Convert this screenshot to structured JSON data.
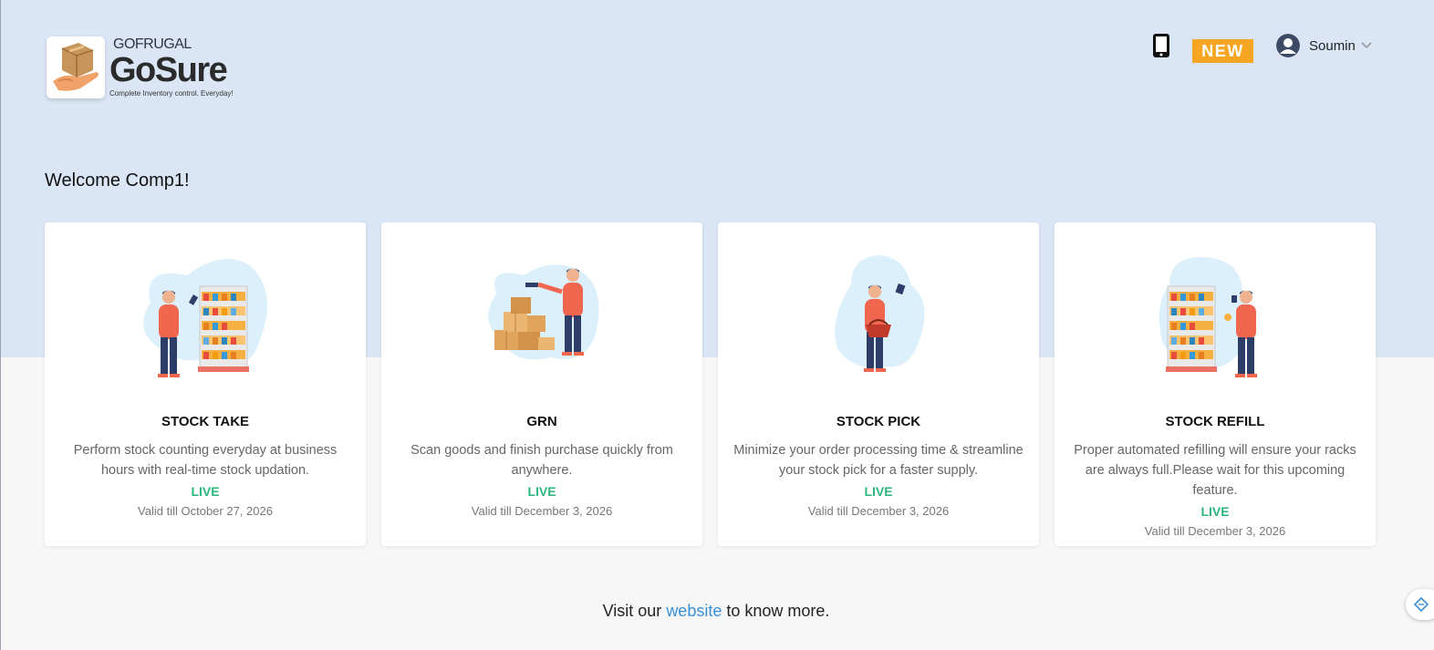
{
  "brand": {
    "company": "GOFRUGAL",
    "product": "GoSure",
    "tagline": "Complete Inventory control. Everyday!"
  },
  "header": {
    "new_badge": "NEW",
    "user_name": "Soumin"
  },
  "welcome": "Welcome Comp1!",
  "cards": [
    {
      "title": "STOCK TAKE",
      "description": "Perform stock counting everyday at business hours with real-time stock updation.",
      "status": "LIVE",
      "valid": "Valid till October 27, 2026",
      "icon": "stock-take-illustration"
    },
    {
      "title": "GRN",
      "description": "Scan goods and finish purchase quickly from anywhere.",
      "status": "LIVE",
      "valid": "Valid till December 3, 2026",
      "icon": "grn-illustration"
    },
    {
      "title": "STOCK PICK",
      "description": "Minimize your order processing time & streamline your stock pick for a faster supply.",
      "status": "LIVE",
      "valid": "Valid till December 3, 2026",
      "icon": "stock-pick-illustration"
    },
    {
      "title": "STOCK REFILL",
      "description": "Proper automated refilling will ensure your racks are always full.Please wait for this upcoming feature.",
      "status": "LIVE",
      "valid": "Valid till December 3, 2026",
      "icon": "stock-refill-illustration"
    }
  ],
  "footer": {
    "prefix": "Visit our",
    "link": "website",
    "suffix": "to know more."
  },
  "colors": {
    "hero_bg": "#dae6f5",
    "live": "#2cb67d",
    "link": "#3a8fd4",
    "new_badge": "#f6a623"
  }
}
